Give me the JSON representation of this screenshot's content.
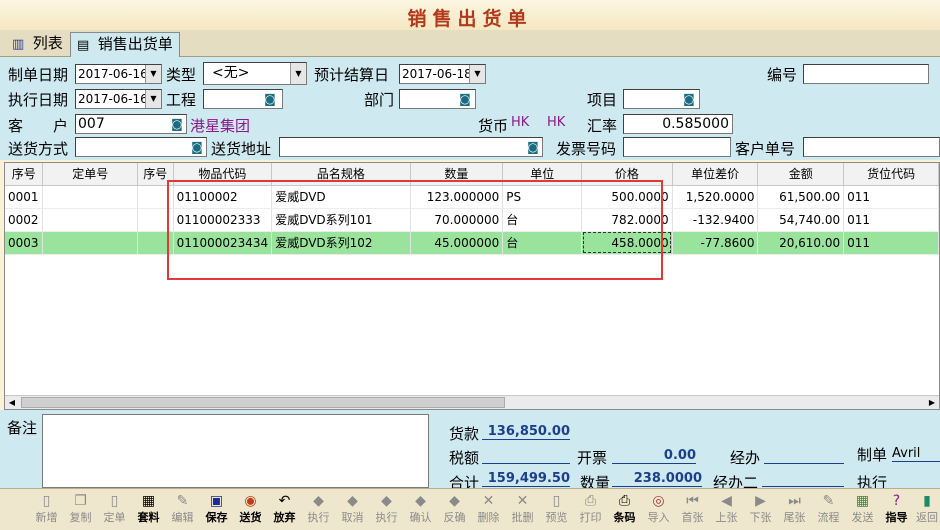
{
  "window_title": "销售出货单",
  "tabs": [
    {
      "label": "列表",
      "icon": "list-icon"
    },
    {
      "label": "销售出货单",
      "icon": "document-icon"
    }
  ],
  "form": {
    "make_date_label": "制单日期",
    "make_date": "2017-06-16",
    "type_label": "类型",
    "type_value": "<无>",
    "settle_date_label": "预计结算日",
    "settle_date": "2017-06-18",
    "number_label": "编号",
    "number_value": "",
    "exec_date_label": "执行日期",
    "exec_date": "2017-06-16",
    "project_label": "工程",
    "project_value": "",
    "dept_label": "部门",
    "dept_value": "",
    "item_label": "项目",
    "item_value": "",
    "customer_label": "客　　户",
    "customer_code": "007",
    "customer_name": "港星集团",
    "currency_label": "货币",
    "currency_code": "HK",
    "currency_name": "HK",
    "rate_label": "汇率",
    "rate_value": "0.585000",
    "delivery_label": "送货方式",
    "delivery_value": "",
    "address_label": "送货地址",
    "address_value": "",
    "invoice_label": "发票号码",
    "invoice_value": "",
    "cust_order_label": "客户单号",
    "cust_order_value": ""
  },
  "grid": {
    "headers": [
      "序号",
      "定单号",
      "序号",
      "物品代码",
      "品名规格",
      "数量",
      "单位",
      "价格",
      "单位差价",
      "金额",
      "货位代码"
    ],
    "rows": [
      [
        "0001",
        "",
        "",
        "01100002",
        "爱威DVD",
        "123.000000",
        "PS",
        "500.0000",
        "1,520.0000",
        "61,500.00",
        "011"
      ],
      [
        "0002",
        "",
        "",
        "01100002333",
        "爱威DVD系列101",
        "70.000000",
        "台",
        "782.0000",
        "-132.9400",
        "54,740.00",
        "011"
      ],
      [
        "0003",
        "",
        "",
        "011000023434",
        "爱威DVD系列102",
        "45.000000",
        "台",
        "458.0000",
        "-77.8600",
        "20,610.00",
        "011"
      ]
    ],
    "selected_row": 2
  },
  "footer": {
    "memo_label": "备注",
    "memo_value": "",
    "payment_label": "货款",
    "payment_value": "136,850.00",
    "tax_label": "税额",
    "invoice_open_label": "开票",
    "invoice_open_value": "0.00",
    "handler_label": "经办",
    "maker_label": "制单",
    "maker_value": "Avril",
    "total_label": "合计",
    "total_value": "159,499.50",
    "qty_label": "数量",
    "qty_value": "238.0000",
    "handler2_label": "经办二",
    "executor_label": "执行"
  },
  "toolbar": [
    {
      "label": "新增",
      "icon": "new-icon",
      "enabled": false
    },
    {
      "label": "复制",
      "icon": "copy-icon",
      "enabled": false
    },
    {
      "label": "定单",
      "icon": "order-icon",
      "enabled": false
    },
    {
      "label": "套料",
      "icon": "materials-icon",
      "enabled": true
    },
    {
      "label": "编辑",
      "icon": "edit-icon",
      "enabled": false
    },
    {
      "label": "保存",
      "icon": "save-icon",
      "enabled": true
    },
    {
      "label": "送货",
      "icon": "delivery-icon",
      "enabled": true
    },
    {
      "label": "放弃",
      "icon": "undo-icon",
      "enabled": true
    },
    {
      "label": "执行",
      "icon": "execute-icon",
      "enabled": false
    },
    {
      "label": "取消",
      "icon": "cancel-icon",
      "enabled": false
    },
    {
      "label": "执行",
      "icon": "execute2-icon",
      "enabled": false
    },
    {
      "label": "确认",
      "icon": "confirm-icon",
      "enabled": false
    },
    {
      "label": "反确",
      "icon": "unconfirm-icon",
      "enabled": false
    },
    {
      "label": "删除",
      "icon": "delete-icon",
      "enabled": false
    },
    {
      "label": "批删",
      "icon": "batch-delete-icon",
      "enabled": false
    },
    {
      "label": "预览",
      "icon": "preview-icon",
      "enabled": false
    },
    {
      "label": "打印",
      "icon": "print-icon",
      "enabled": false
    },
    {
      "label": "条码",
      "icon": "barcode-icon",
      "enabled": true
    },
    {
      "label": "导入",
      "icon": "import-icon",
      "enabled": false
    },
    {
      "label": "首张",
      "icon": "first-icon",
      "enabled": false
    },
    {
      "label": "上张",
      "icon": "prev-icon",
      "enabled": false
    },
    {
      "label": "下张",
      "icon": "next-icon",
      "enabled": false
    },
    {
      "label": "尾张",
      "icon": "last-icon",
      "enabled": false
    },
    {
      "label": "流程",
      "icon": "flow-icon",
      "enabled": false
    },
    {
      "label": "发送",
      "icon": "send-icon",
      "enabled": false
    },
    {
      "label": "指导",
      "icon": "guide-icon",
      "enabled": true
    },
    {
      "label": "返回",
      "icon": "exit-icon",
      "enabled": false
    }
  ]
}
